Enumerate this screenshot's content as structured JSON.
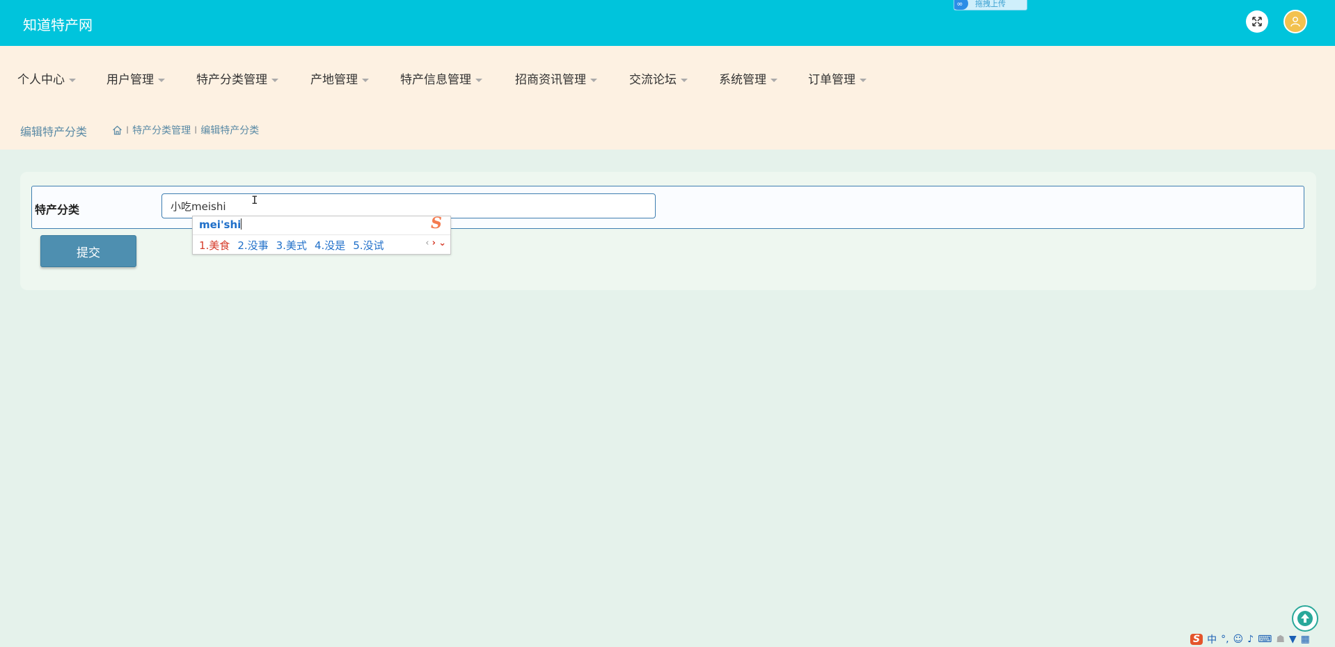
{
  "header": {
    "brand": "知道特产网",
    "upload_chip": "拖拽上传"
  },
  "nav": {
    "items": [
      {
        "label": "个人中心"
      },
      {
        "label": "用户管理"
      },
      {
        "label": "特产分类管理"
      },
      {
        "label": "产地管理"
      },
      {
        "label": "特产信息管理"
      },
      {
        "label": "招商资讯管理"
      },
      {
        "label": "交流论坛"
      },
      {
        "label": "系统管理"
      },
      {
        "label": "订单管理"
      }
    ]
  },
  "breadcrumb": {
    "page_title": "编辑特产分类",
    "crumbs": [
      "特产分类管理",
      "编辑特产分类"
    ],
    "separator": "I"
  },
  "form": {
    "label": "特产分类",
    "input_value": "小吃meishi",
    "submit_label": "提交"
  },
  "ime": {
    "composition": "mei'shi",
    "candidates": [
      "1.美食",
      "2.没事",
      "3.美式",
      "4.没是",
      "5.没试"
    ]
  },
  "tray": {
    "lang": "中"
  },
  "colors": {
    "topbar": "#00c4dc",
    "nav_bg": "#fdf1e2",
    "page_bg": "#e5f2eb",
    "button": "#4e8fb0"
  }
}
